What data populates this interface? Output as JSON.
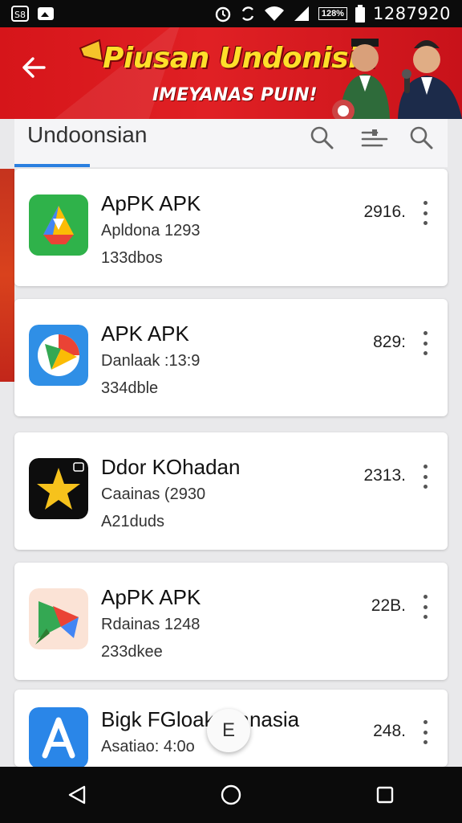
{
  "status_bar": {
    "battery_percent": "128%",
    "time": "1287920",
    "icons": [
      "sim-icon",
      "image-icon",
      "alarm-icon",
      "sync-icon",
      "wifi-icon",
      "signal-icon",
      "battery-icon"
    ]
  },
  "banner": {
    "title": "Piusan Undonisia",
    "subtitle": "IMEYANAS PUIN!",
    "background": "#d6151a",
    "title_color": "#ffdf2a"
  },
  "search": {
    "query": "Undoonsian",
    "accent": "#2a7fe0",
    "icons": [
      "search-icon",
      "filter-icon",
      "search-icon"
    ]
  },
  "apps": [
    {
      "name": "ApPK APK",
      "meta": "Apldona 1293",
      "downloads": "133dbos",
      "number": "2916.",
      "icon": "google-drive-icon"
    },
    {
      "name": "APK APK",
      "meta": "Danlaak :13:9",
      "downloads": "334dble",
      "number": "829:",
      "icon": "maps-icon"
    },
    {
      "name": "Ddor KOhadan",
      "meta": "Caainas (2930",
      "downloads": "A21duds",
      "number": "2313.",
      "icon": "star-icon"
    },
    {
      "name": "ApPK APK",
      "meta": "Rdainas 1248",
      "downloads": "233dkee",
      "number": "22B.",
      "icon": "play-icon"
    },
    {
      "name": "Bigk FGloak Inanasia",
      "meta": "Asatiao: 4:0o",
      "downloads": "",
      "number": "248.",
      "icon": "app-store-icon"
    }
  ],
  "fab": {
    "label": "E"
  },
  "nav": [
    "back-icon",
    "home-icon",
    "recents-icon"
  ]
}
